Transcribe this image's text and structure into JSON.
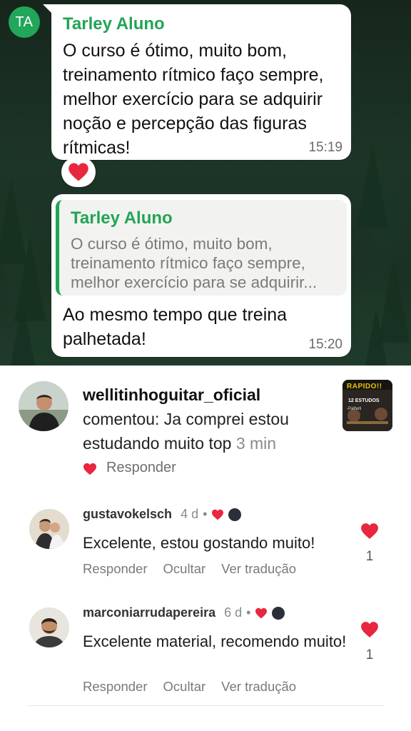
{
  "chat": {
    "avatar_initials": "TA",
    "message1": {
      "sender": "Tarley Aluno",
      "text": "O curso é ótimo, muito bom, treinamento rítmico faço sempre, melhor exercício para se adquirir noção e percepção das figuras rítmicas!",
      "time": "15:19",
      "reaction": "heart"
    },
    "message2": {
      "quote_sender": "Tarley Aluno",
      "quote_text": "O curso é ótimo, muito bom, treinamento rítmico faço sempre, melhor exercício para se adquirir...",
      "text": "Ao mesmo tempo que treina palhetada!",
      "time": "15:20"
    }
  },
  "notification": {
    "username": "wellitinhoguitar_oficial",
    "text": "comentou: Ja comprei estou estudando muito top",
    "age": "3 min",
    "reply_label": "Responder",
    "thumbnail": {
      "title": "RAPIDO!!",
      "subtitle": "12 ESTUDOS",
      "caption": "-Palheti"
    }
  },
  "comments": [
    {
      "username": "gustavokelsch",
      "age": "4 d",
      "separator": "•",
      "text": "Excelente, estou gostando muito!",
      "likes": "1",
      "actions": [
        "Responder",
        "Ocultar",
        "Ver tradução"
      ]
    },
    {
      "username": "marconiarrudapereira",
      "age": "6 d",
      "separator": "•",
      "text": "Excelente material, recomendo muito!",
      "likes": "1",
      "actions": [
        "Responder",
        "Ocultar",
        "Ver tradução"
      ]
    }
  ],
  "colors": {
    "accent_green": "#22a455",
    "like_red": "#e8263f",
    "chat_bg": "#1d3527"
  }
}
